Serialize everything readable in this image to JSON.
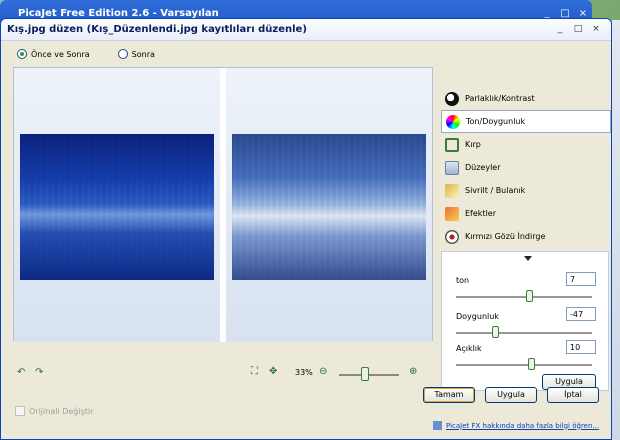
{
  "background_window": {
    "title": "PicaJet Free Edition 2.6 - Varsayılan"
  },
  "dialog": {
    "title": "Kış.jpg düzen (Kış_Düzenlendi.jpg kayıtlıları düzenle)",
    "view_options": [
      {
        "label": "Önce ve Sonra",
        "selected": true
      },
      {
        "label": "Sonra",
        "selected": false
      }
    ],
    "zoom": "33%",
    "tools": [
      {
        "label": "Parlaklık/Kontrast",
        "icon": "brightness-contrast-icon",
        "selected": false
      },
      {
        "label": "Ton/Doygunluk",
        "icon": "hue-saturation-icon",
        "selected": true
      },
      {
        "label": "Kırp",
        "icon": "crop-icon",
        "selected": false
      },
      {
        "label": "Düzeyler",
        "icon": "levels-icon",
        "selected": false
      },
      {
        "label": "Sivrilt / Bulanık",
        "icon": "sharpen-blur-icon",
        "selected": false
      },
      {
        "label": "Efektler",
        "icon": "effects-icon",
        "selected": false
      },
      {
        "label": "Kırmızı Gözü İndirge",
        "icon": "red-eye-icon",
        "selected": false
      }
    ],
    "adjustments": {
      "hue": {
        "label": "ton",
        "value": "7"
      },
      "saturation": {
        "label": "Doygunluk",
        "value": "-47"
      },
      "lightness": {
        "label": "Açıklık",
        "value": "10"
      },
      "apply_label": "Uygula"
    },
    "replace_original_label": "Orijinali Değiştir",
    "ok_label": "Tamam",
    "apply_label": "Uygula",
    "cancel_label": "İptal",
    "learn_more_link": "PicaJet FX hakkında daha fazla bilgi öğren..."
  }
}
